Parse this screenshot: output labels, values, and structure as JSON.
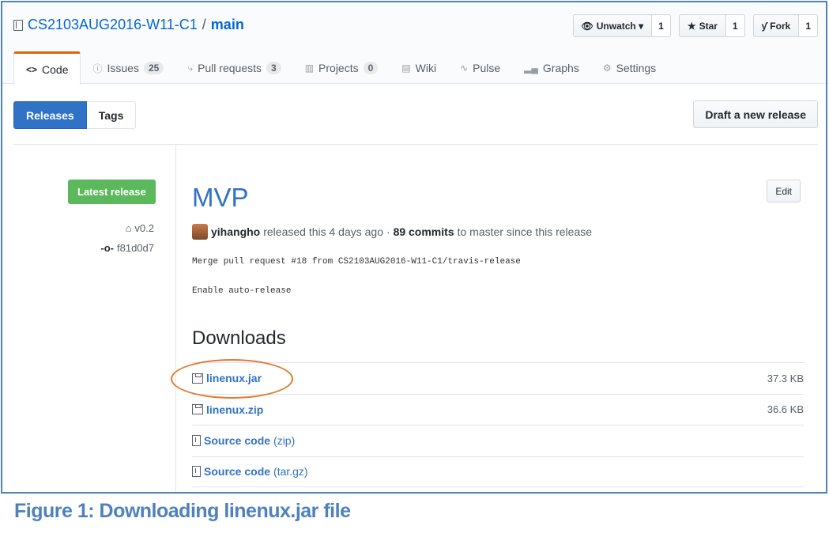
{
  "repo": {
    "owner": "CS2103AUG2016-W11-C1",
    "separator": "/",
    "name": "main"
  },
  "actions": {
    "unwatch": {
      "label": "Unwatch ▾",
      "count": "1"
    },
    "star": {
      "label": "Star",
      "count": "1"
    },
    "fork": {
      "label": "Fork",
      "count": "1"
    }
  },
  "tabs": [
    {
      "label": "Code",
      "count": ""
    },
    {
      "label": "Issues",
      "count": "25"
    },
    {
      "label": "Pull requests",
      "count": "3"
    },
    {
      "label": "Projects",
      "count": "0"
    },
    {
      "label": "Wiki",
      "count": ""
    },
    {
      "label": "Pulse",
      "count": ""
    },
    {
      "label": "Graphs",
      "count": ""
    },
    {
      "label": "Settings",
      "count": ""
    }
  ],
  "subnav": {
    "releases": "Releases",
    "tags": "Tags",
    "draft": "Draft a new release"
  },
  "sidebar": {
    "latest": "Latest release",
    "tag": "v0.2",
    "commit": "f81d0d7"
  },
  "release": {
    "title": "MVP",
    "edit": "Edit",
    "user": "yihangho",
    "released_text": "released this 4 days ago ·",
    "commits": "89 commits",
    "commits_suffix": "to master since this release",
    "body_line1": "Merge pull request #18 from CS2103AUG2016-W11-C1/travis-release",
    "body_line2": "Enable auto-release"
  },
  "downloads": {
    "heading": "Downloads",
    "items": [
      {
        "name": "linenux.jar",
        "suffix": "",
        "size": "37.3 KB"
      },
      {
        "name": "linenux.zip",
        "suffix": "",
        "size": "36.6 KB"
      },
      {
        "name": "Source code",
        "suffix": "(zip)",
        "size": ""
      },
      {
        "name": "Source code",
        "suffix": "(tar.gz)",
        "size": ""
      }
    ]
  },
  "caption": "Figure 1: Downloading linenux.jar file",
  "colors": {
    "accent": "#3072c6",
    "success": "#5cb85c",
    "highlight": "#e07b31",
    "caption": "#4f81bd"
  }
}
